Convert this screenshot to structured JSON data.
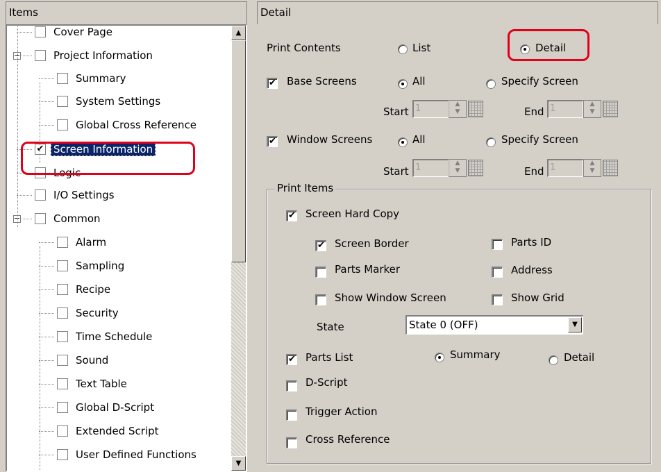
{
  "items_panel": {
    "title": "Items",
    "tree": [
      {
        "label": "Cover Page",
        "checked": false
      },
      {
        "label": "Project Information",
        "checked": false,
        "expander": "−"
      },
      {
        "label": "Summary",
        "checked": false
      },
      {
        "label": "System Settings",
        "checked": false
      },
      {
        "label": "Global Cross Reference",
        "checked": false
      },
      {
        "label": "Screen Information",
        "checked": true,
        "selected": true
      },
      {
        "label": "Logic",
        "checked": false
      },
      {
        "label": "I/O Settings",
        "checked": false
      },
      {
        "label": "Common",
        "checked": false,
        "expander": "−"
      },
      {
        "label": "Alarm",
        "checked": false
      },
      {
        "label": "Sampling",
        "checked": false
      },
      {
        "label": "Recipe",
        "checked": false
      },
      {
        "label": "Security",
        "checked": false
      },
      {
        "label": "Time Schedule",
        "checked": false
      },
      {
        "label": "Sound",
        "checked": false
      },
      {
        "label": "Text Table",
        "checked": false
      },
      {
        "label": "Global D-Script",
        "checked": false
      },
      {
        "label": "Extended Script",
        "checked": false
      },
      {
        "label": "User Defined Functions",
        "checked": false
      }
    ]
  },
  "detail_panel": {
    "title": "Detail",
    "print_contents": {
      "label": "Print Contents",
      "list": "List",
      "detail": "Detail",
      "selected": "Detail"
    },
    "base_screens": {
      "label": "Base Screens",
      "checked": true,
      "all": "All",
      "specify": "Specify Screen",
      "selected": "All",
      "start_label": "Start",
      "end_label": "End",
      "start_value": "1",
      "end_value": "1"
    },
    "window_screens": {
      "label": "Window Screens",
      "checked": true,
      "all": "All",
      "specify": "Specify Screen",
      "selected": "All",
      "start_label": "Start",
      "end_label": "End",
      "start_value": "1",
      "end_value": "1"
    },
    "print_items": {
      "title": "Print Items",
      "screen_hard_copy": {
        "label": "Screen Hard Copy",
        "checked": true
      },
      "screen_border": {
        "label": "Screen Border",
        "checked": true
      },
      "parts_id": {
        "label": "Parts ID",
        "checked": false
      },
      "parts_marker": {
        "label": "Parts Marker",
        "checked": false
      },
      "address": {
        "label": "Address",
        "checked": false
      },
      "show_window_screen": {
        "label": "Show Window Screen",
        "checked": false
      },
      "show_grid": {
        "label": "Show Grid",
        "checked": false
      },
      "state": {
        "label": "State",
        "value": "State 0 (OFF)"
      },
      "parts_list": {
        "label": "Parts List",
        "checked": true,
        "summary": "Summary",
        "detail": "Detail",
        "selected": "Summary"
      },
      "d_script": {
        "label": "D-Script",
        "checked": false
      },
      "trigger_action": {
        "label": "Trigger Action",
        "checked": false
      },
      "cross_reference": {
        "label": "Cross Reference",
        "checked": false
      }
    }
  },
  "icons": {
    "check": "✔",
    "scroll_up": "▲",
    "scroll_down": "▼",
    "dropdown": "▼"
  },
  "colors": {
    "highlight": "#e0001a",
    "selection": "#0a246a"
  }
}
